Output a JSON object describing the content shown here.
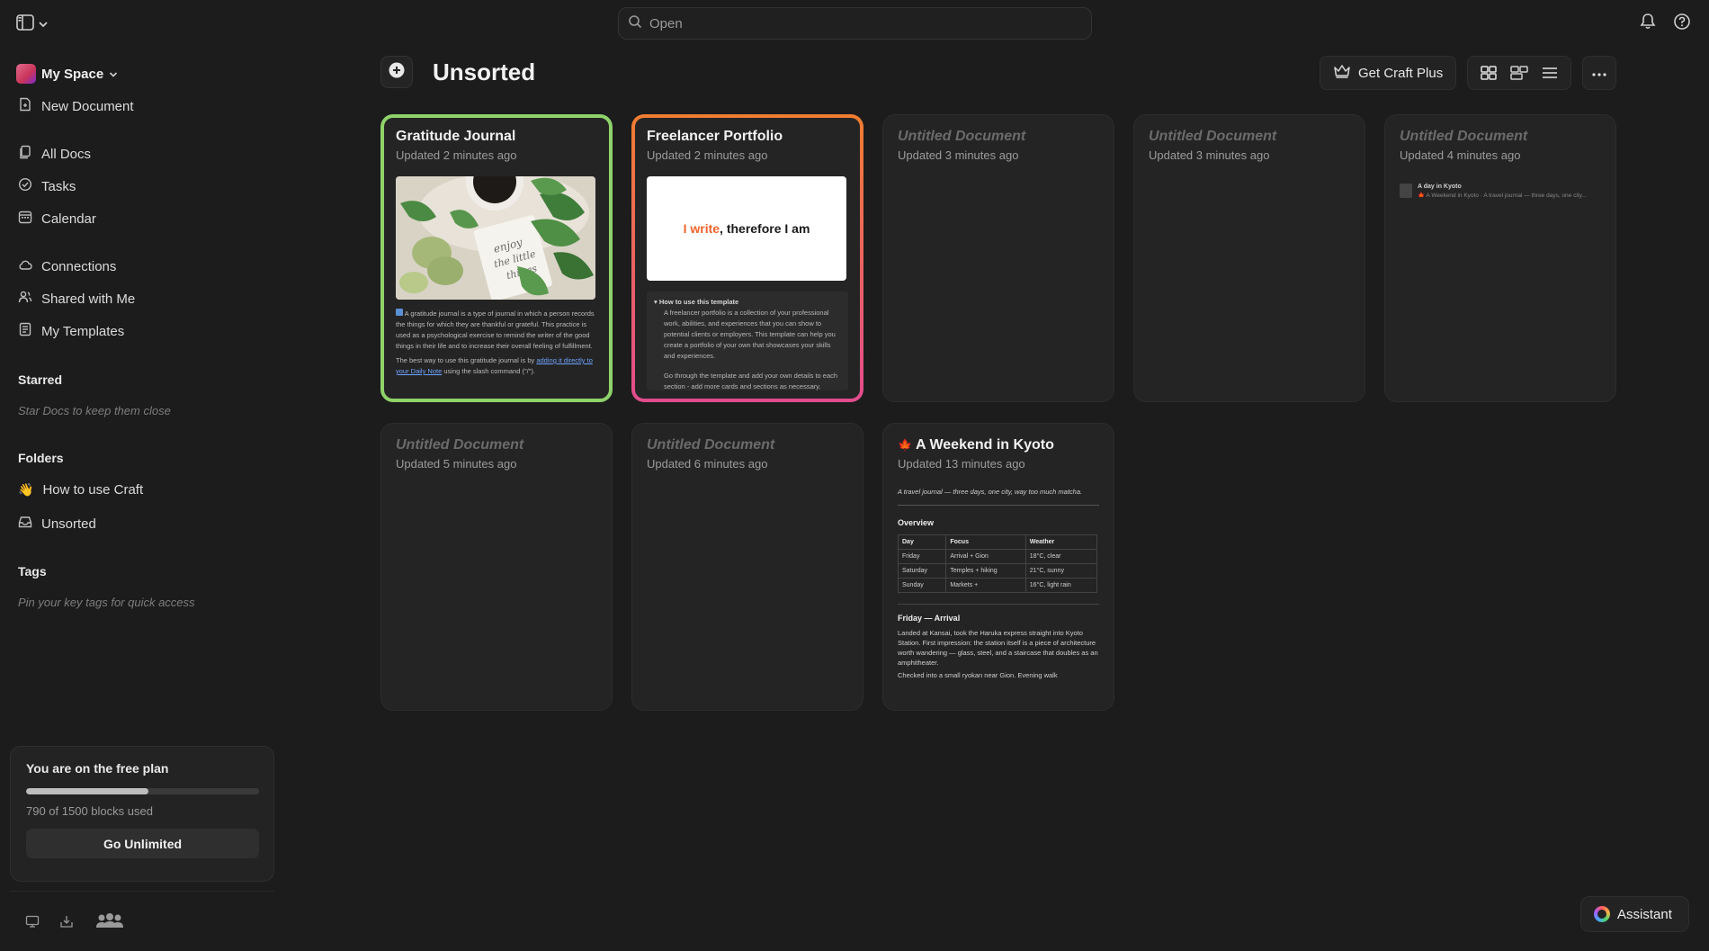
{
  "topbar": {
    "search_placeholder": "Open"
  },
  "sidebar": {
    "space_name": "My Space",
    "new_document": "New Document",
    "nav": [
      {
        "label": "All Docs",
        "icon": "docs-icon"
      },
      {
        "label": "Tasks",
        "icon": "check-circle-icon"
      },
      {
        "label": "Calendar",
        "icon": "calendar-icon"
      },
      {
        "label": "Connections",
        "icon": "cloud-icon"
      },
      {
        "label": "Shared with Me",
        "icon": "people-icon"
      },
      {
        "label": "My Templates",
        "icon": "template-icon"
      }
    ],
    "starred_title": "Starred",
    "starred_hint": "Star Docs to keep them close",
    "folders_title": "Folders",
    "folders": [
      {
        "label": "How to use Craft",
        "emoji": "👋"
      },
      {
        "label": "Unsorted",
        "icon": "inbox-icon"
      }
    ],
    "tags_title": "Tags",
    "tags_hint": "Pin your key tags for quick access",
    "plan": {
      "title": "You are on the free plan",
      "used": 790,
      "total": 1500,
      "usage_text": "790 of 1500 blocks used",
      "button": "Go Unlimited"
    }
  },
  "header": {
    "title": "Unsorted",
    "craft_plus": "Get Craft Plus"
  },
  "cards": [
    {
      "title": "Gratitude Journal",
      "updated": "Updated 2 minutes ago",
      "preview_1": "A gratitude journal is a type of journal in which a person records the things for which they are thankful or grateful. This practice is used as a psychological exercise to remind the writer of the good things in their life and to increase their overall feeling of fulfillment.",
      "preview_2a": "The best way to use this gratitude journal is by ",
      "preview_2_link": "adding it directly to your Daily Note",
      "preview_2b": " using the slash command (\"/\")."
    },
    {
      "title": "Freelancer Portfolio",
      "updated": "Updated 2 minutes ago",
      "banner_accent": "I write",
      "banner_rest": ", therefore I am",
      "toggle_title": "How to use this template",
      "preview_1": "A freelancer portfolio is a collection of your professional work, abilities, and experiences that you can show to potential clients or employers. This template can help you create a portfolio of your own that showcases your skills and experiences.",
      "preview_2": "Go through the template and add your own details to each section - add more cards and sections as necessary."
    },
    {
      "title": "Untitled Document",
      "updated": "Updated 3 minutes ago"
    },
    {
      "title": "Untitled Document",
      "updated": "Updated 3 minutes ago"
    },
    {
      "title": "Untitled Document",
      "updated": "Updated 4 minutes ago",
      "mini_title": "A day in Kyoto",
      "mini_sub": "🍁 A Weekend in Kyoto · A travel journal — three days, one city..."
    },
    {
      "title": "Untitled Document",
      "updated": "Updated 5 minutes ago"
    },
    {
      "title": "Untitled Document",
      "updated": "Updated 6 minutes ago"
    },
    {
      "emoji": "🍁",
      "title": "A Weekend in Kyoto",
      "updated": "Updated 13 minutes ago",
      "intro": "A travel journal — three days, one city, way too much matcha.",
      "overview": "Overview",
      "table_head": [
        "Day",
        "Focus",
        "Weather"
      ],
      "table_rows": [
        [
          "Friday",
          "Arrival + Gion",
          "18°C, clear"
        ],
        [
          "Saturday",
          "Temples + hiking",
          "21°C, sunny"
        ],
        [
          "Sunday",
          "Markets +",
          "16°C, light rain"
        ]
      ],
      "section": "Friday — Arrival",
      "para_1": "Landed at Kansai, took the Haruka express straight into Kyoto Station. First impression: the station itself is a piece of architecture worth wandering — glass, steel, and a staircase that doubles as an amphitheater.",
      "para_2": "Checked into a small ryokan near Gion. Evening walk"
    }
  ],
  "assistant": "Assistant"
}
